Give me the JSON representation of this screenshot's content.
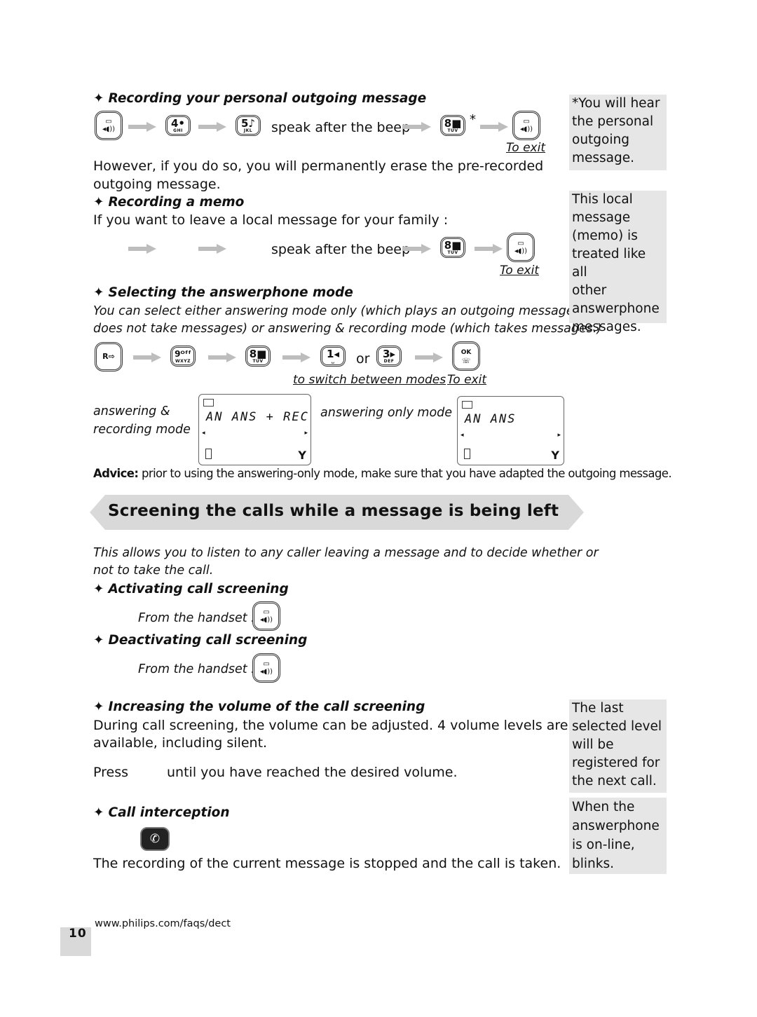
{
  "page": {
    "number": "10",
    "footer_url": "www.philips.com/faqs/dect"
  },
  "section_record_ogm": {
    "title": "Recording your personal outgoing message",
    "step_text": "speak after the beep",
    "asterisk": "*",
    "exit_label": "To exit",
    "body": [
      "However, if you do so, you will permanently erase the pre-recorded",
      "outgoing message."
    ],
    "keys": [
      {
        "icon": "answerphone-key",
        "main": "▭",
        "sub": "◂◖))"
      },
      {
        "icon": "key-4",
        "main": "4•",
        "sub": "GHI"
      },
      {
        "icon": "key-5",
        "main": "5♪",
        "sub": "JKL"
      },
      {
        "icon": "key-8",
        "main": "8■",
        "sub": "TUV"
      },
      {
        "icon": "answerphone-key",
        "main": "▭",
        "sub": "◂◖))"
      }
    ]
  },
  "section_memo": {
    "title": "Recording a memo",
    "intro": "If you want to leave a local message for your family :",
    "step_text": "speak after the beep",
    "exit_label": "To exit",
    "keys": [
      {
        "icon": "key-8",
        "main": "8■",
        "sub": "TUV"
      },
      {
        "icon": "answerphone-key",
        "main": "▭",
        "sub": "◂◖))"
      }
    ]
  },
  "section_mode": {
    "title": "Selecting the answerphone mode",
    "body": [
      "You can select either answering mode only (which plays an outgoing message but",
      "does not take messages) or answering & recording mode (which takes messages.)"
    ],
    "or_label": "or",
    "switch_label": "to switch between modes",
    "exit_label": "To exit",
    "keys": [
      {
        "icon": "redial-key",
        "main": "R⇨",
        "sub": ""
      },
      {
        "icon": "key-9",
        "main": "9off",
        "sub": "WXYZ"
      },
      {
        "icon": "key-8",
        "main": "8■",
        "sub": "TUV"
      },
      {
        "icon": "key-1",
        "main": "1◂",
        "sub": "␣"
      },
      {
        "icon": "key-3",
        "main": "3▸",
        "sub": "DEF"
      },
      {
        "icon": "ok-key",
        "main": "OK",
        "sub": "☏"
      }
    ],
    "lcd_modes": [
      {
        "label": [
          "answering &",
          "recording mode"
        ],
        "display": "AN ANS + REC"
      },
      {
        "label": [
          "answering only mode"
        ],
        "display": "AN ANS"
      }
    ]
  },
  "advice": {
    "label": "Advice:",
    "text": " prior to using the answering-only mode, make sure that you have adapted the outgoing message."
  },
  "screening": {
    "heading": "Screening the calls while a message is being left",
    "intro": [
      "This allows you to listen to any caller leaving a message and to decide whether or",
      "not to take the call."
    ],
    "activate_title": "Activating call screening",
    "activate_text": "From the handset :",
    "deactivate_title": "Deactivating call screening",
    "deactivate_text": "From the handset :",
    "volume_title": "Increasing the volume of the call screening",
    "volume_body": [
      "During call screening, the volume can be adjusted. 4 volume levels are",
      "available, including silent."
    ],
    "press_label": "Press",
    "press_rest": "until you have reached the desired volume.",
    "intercept_title": "Call interception",
    "intercept_text": "The recording of the current message is stopped and the call is taken."
  },
  "side_notes": [
    "*You will hear the personal outgoing message.",
    "This local message (memo) is treated like all other answerphone messages.",
    "The last selected level will be registered for the next call.",
    "When the answerphone is on-line, blinks."
  ],
  "side_notes_lines": [
    [
      "*You will hear",
      "the personal",
      "outgoing",
      "message."
    ],
    [
      "This local",
      "message",
      "(memo) is",
      "treated like all",
      "other",
      "answerphone",
      "messages."
    ],
    [
      "The last",
      "selected level",
      "will be",
      "registered for",
      "the next call."
    ],
    [
      "When the",
      "answerphone",
      "is on-line,",
      "blinks."
    ]
  ],
  "colors": {
    "note_bg": "#e6e6e6",
    "banner_bg": "#d9d9d9",
    "arrow": "#bdbdbd"
  }
}
